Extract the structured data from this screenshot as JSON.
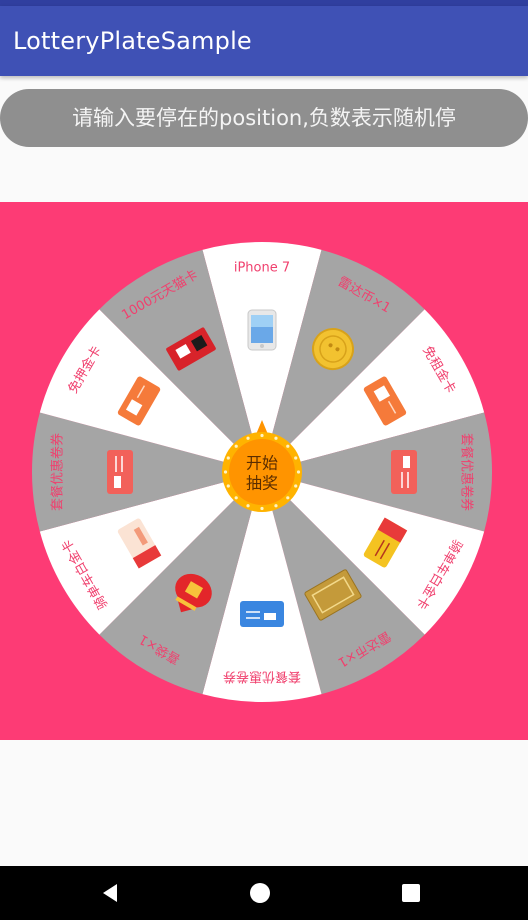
{
  "app": {
    "title": "LotteryPlateSample"
  },
  "input": {
    "placeholder": "请输入要停在的position,负数表示随机停",
    "value": ""
  },
  "wheel": {
    "center_button_label": "开始抽奖",
    "prizes": [
      {
        "label": "iPhone 7",
        "icon": "iphone-icon"
      },
      {
        "label": "雷达币×1",
        "icon": "coin-icon"
      },
      {
        "label": "免租金卡",
        "icon": "voucher-card-icon"
      },
      {
        "label": "套餐优惠卷券",
        "icon": "coupon-icon"
      },
      {
        "label": "骑单车白金卡",
        "icon": "gold-card-icon"
      },
      {
        "label": "雷达币×1",
        "icon": "gold-bar-icon"
      },
      {
        "label": "套餐优惠卷券",
        "icon": "coupon-blue-icon"
      },
      {
        "label": "喜袋×1",
        "icon": "lucky-bag-icon"
      },
      {
        "label": "骑单车白金卡",
        "icon": "silver-card-icon"
      },
      {
        "label": "套餐优惠卷券",
        "icon": "coupon-icon"
      },
      {
        "label": "免押金卡",
        "icon": "voucher-card-icon"
      },
      {
        "label": "1000元天猫卡",
        "icon": "tmall-card-icon"
      }
    ],
    "colors": {
      "background": "#fd3b75",
      "white_sector": "#ffffff",
      "gray_sector": "#a5a5a5",
      "label": "#f0406e",
      "button": "#ff9400"
    }
  },
  "nav": {
    "back": "back-icon",
    "home": "home-icon",
    "recents": "recents-icon"
  }
}
